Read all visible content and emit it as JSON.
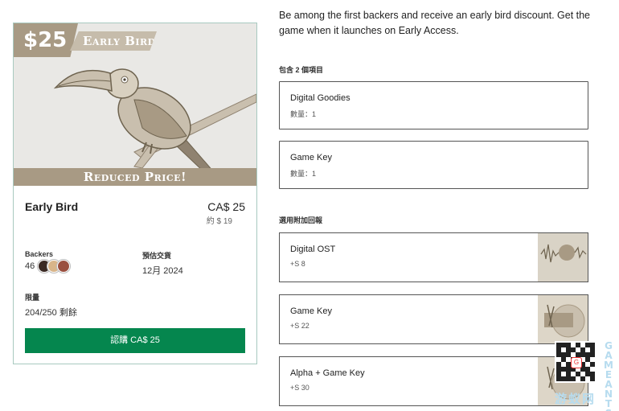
{
  "reward_card": {
    "price_tag": "$25",
    "banner": "Early Bird",
    "reduced": "Reduced Price!",
    "tier_name": "Early Bird",
    "price": "CA$ 25",
    "approx": "約 $ 19",
    "backers_label": "Backers",
    "backers_count": "46",
    "delivery_label": "預估交貨",
    "delivery_value": "12月 2024",
    "limit_label": "限量",
    "limit_value": "204/250 剩餘",
    "pledge_button": "認購 CA$ 25"
  },
  "description": "Be among the first backers and receive an early bird discount. Get the game when it launches on Early Access.",
  "includes": {
    "label": "包含 2 個項目",
    "items": [
      {
        "title": "Digital Goodies",
        "qty": "數量：1"
      },
      {
        "title": "Game Key",
        "qty": "數量：1"
      }
    ]
  },
  "addons": {
    "label": "選用附加回報",
    "items": [
      {
        "title": "Digital OST",
        "price": "+S 8"
      },
      {
        "title": "Game Key",
        "price": "+S 22"
      },
      {
        "title": "Alpha + Game Key",
        "price": "+S 30"
      }
    ]
  },
  "watermark": {
    "vertical": "GAMEANTS",
    "cn": "游蚁网"
  }
}
